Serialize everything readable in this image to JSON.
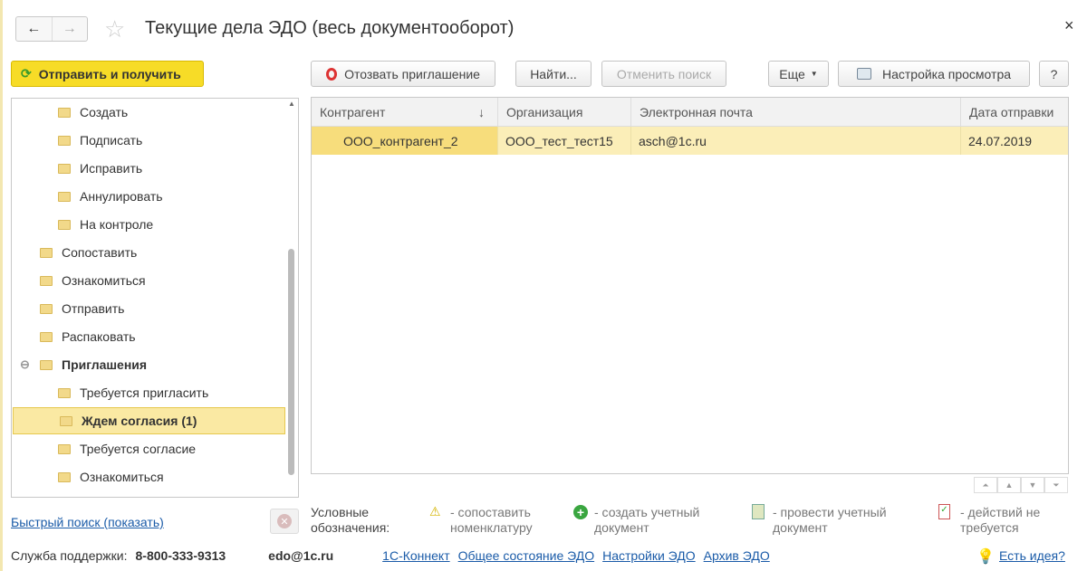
{
  "window": {
    "title": "Текущие дела ЭДО (весь документооборот)",
    "back": "←",
    "forward": "→",
    "close": "×"
  },
  "toolbar": {
    "send_receive": "Отправить и получить",
    "revoke": "Отозвать приглашение",
    "find": "Найти...",
    "cancel_search": "Отменить поиск",
    "more": "Еще",
    "view_settings": "Настройка просмотра",
    "help": "?"
  },
  "tree": [
    {
      "label": "Создать",
      "level": 2
    },
    {
      "label": "Подписать",
      "level": 2
    },
    {
      "label": "Исправить",
      "level": 2
    },
    {
      "label": "Аннулировать",
      "level": 2
    },
    {
      "label": "На контроле",
      "level": 2
    },
    {
      "label": "Сопоставить",
      "level": 1
    },
    {
      "label": "Ознакомиться",
      "level": 1
    },
    {
      "label": "Отправить",
      "level": 1
    },
    {
      "label": "Распаковать",
      "level": 1
    },
    {
      "label": "Приглашения",
      "level": 1,
      "expanded": true
    },
    {
      "label": "Требуется пригласить",
      "level": 2
    },
    {
      "label": "Ждем согласия (1)",
      "level": 2,
      "selected": true
    },
    {
      "label": "Требуется согласие",
      "level": 2
    },
    {
      "label": "Ознакомиться",
      "level": 2
    }
  ],
  "grid": {
    "columns": [
      "Контрагент",
      "Организация",
      "Электронная почта",
      "Дата отправки"
    ],
    "sort_indicator": "↓",
    "rows": [
      [
        "ООО_контрагент_2",
        "ООО_тест_тест15",
        "asch@1c.ru",
        "24.07.2019"
      ]
    ]
  },
  "quick_search": "Быстрый поиск (показать)",
  "legend": {
    "title": "Условные обозначения:",
    "items": [
      "- сопоставить номенклатуру",
      "- создать учетный документ",
      "- провести учетный документ",
      "- действий не требуется"
    ]
  },
  "footer": {
    "support_label": "Служба поддержки:",
    "phone": "8-800-333-9313",
    "email": "edo@1c.ru",
    "links": [
      "1С-Коннект",
      "Общее состояние ЭДО",
      "Настройки ЭДО",
      "Архив ЭДО"
    ],
    "idea": "Есть идея?"
  },
  "colors": {
    "accent": "#f7dc27",
    "selection": "#fae9a3",
    "link": "#1a5ba8"
  }
}
